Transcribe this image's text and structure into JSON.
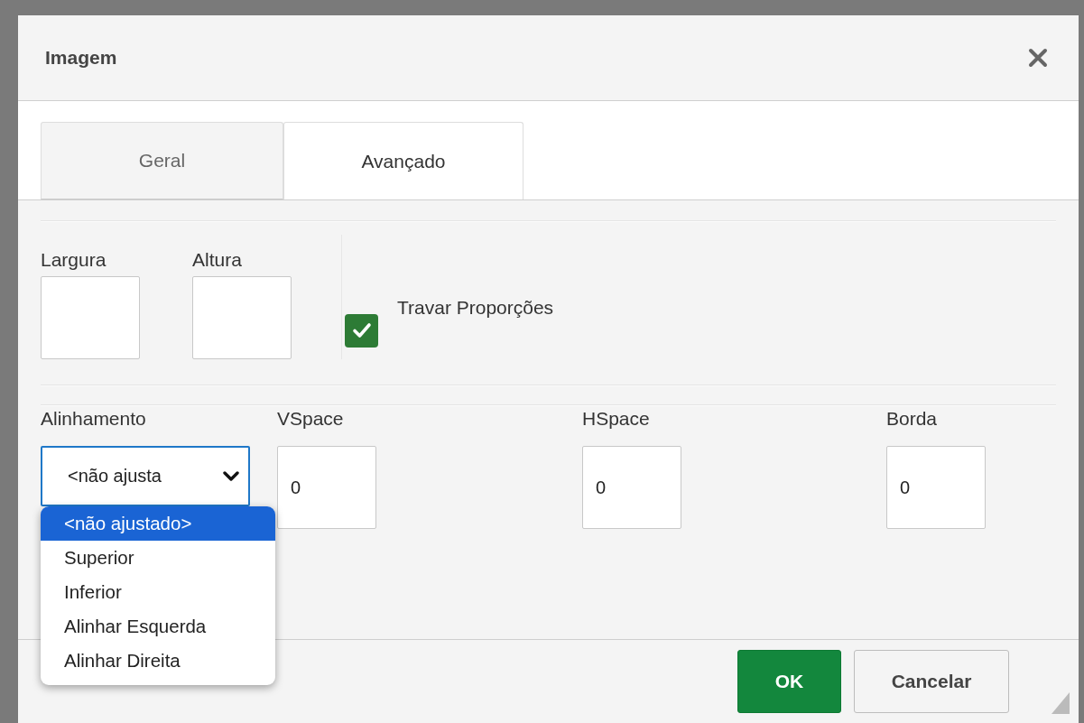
{
  "dialog": {
    "title": "Imagem"
  },
  "tabs": [
    {
      "label": "Geral",
      "selected": false
    },
    {
      "label": "Avançado",
      "selected": true
    }
  ],
  "size_fields": [
    {
      "label": "Largura"
    },
    {
      "label": "Altura"
    }
  ],
  "lock_ratio": {
    "label": "Travar Proporções",
    "checked": true
  },
  "alignment": {
    "label": "Alinhamento",
    "value": "<não ajusta",
    "expanded": true,
    "options": [
      {
        "label": "<não ajustado>",
        "selected": true
      },
      {
        "label": "Superior",
        "selected": false
      },
      {
        "label": "Inferior",
        "selected": false
      },
      {
        "label": "Alinhar Esquerda",
        "selected": false
      },
      {
        "label": "Alinhar Direita",
        "selected": false
      }
    ]
  },
  "spacing_fields": [
    {
      "label": "VSpace",
      "value": "0"
    },
    {
      "label": "HSpace",
      "value": "0"
    },
    {
      "label": "Borda",
      "value": "0"
    }
  ],
  "buttons": [
    {
      "label": "OK",
      "kind": "primary"
    },
    {
      "label": "Cancelar",
      "kind": "secondary"
    }
  ]
}
